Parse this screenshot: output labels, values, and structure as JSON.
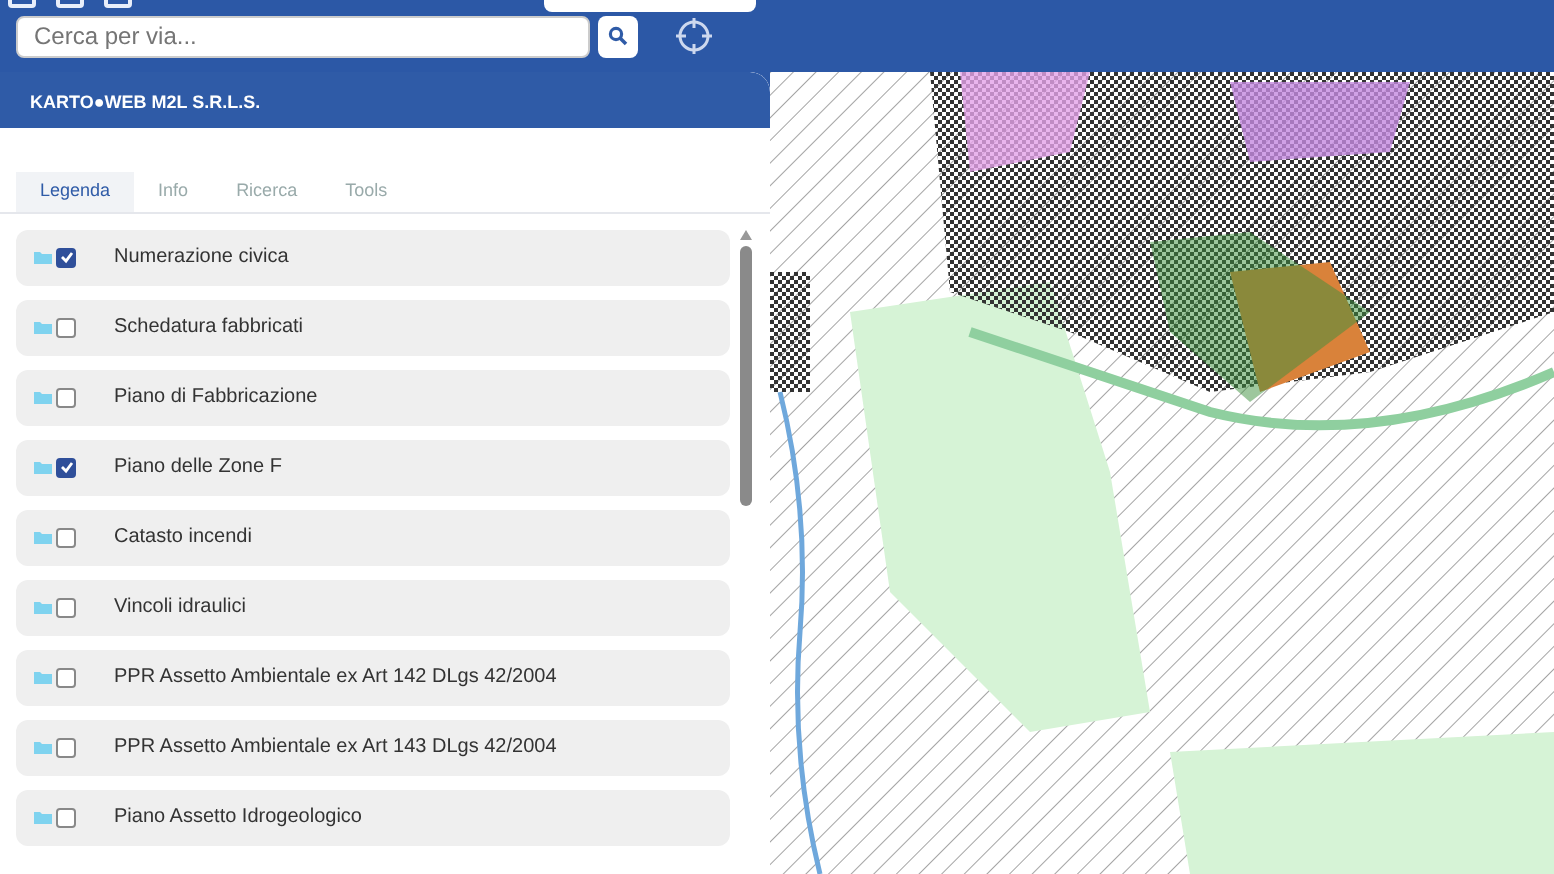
{
  "search": {
    "placeholder": "Cerca per via..."
  },
  "panel": {
    "title": "KARTO●WEB M2L S.R.L.S."
  },
  "tabs": [
    {
      "label": "Legenda",
      "selected": true
    },
    {
      "label": "Info",
      "selected": false
    },
    {
      "label": "Ricerca",
      "selected": false
    },
    {
      "label": "Tools",
      "selected": false
    }
  ],
  "layers": [
    {
      "label": "Numerazione civica",
      "checked": true
    },
    {
      "label": "Schedatura fabbricati",
      "checked": false
    },
    {
      "label": "Piano di Fabbricazione",
      "checked": false
    },
    {
      "label": "Piano delle Zone F",
      "checked": true
    },
    {
      "label": "Catasto incendi",
      "checked": false
    },
    {
      "label": "Vincoli idraulici",
      "checked": false
    },
    {
      "label": "PPR Assetto Ambientale ex Art 142 DLgs 42/2004",
      "checked": false
    },
    {
      "label": "PPR Assetto Ambientale ex Art 143 DLgs 42/2004",
      "checked": false
    },
    {
      "label": "Piano Assetto Idrogeologico",
      "checked": false
    }
  ]
}
